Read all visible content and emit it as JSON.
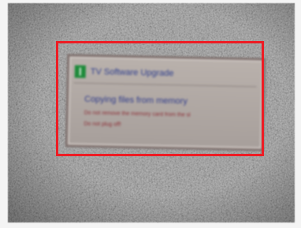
{
  "dialog": {
    "title": "TV Software Upgrade",
    "icon": "tv-app-icon",
    "message": "Copying files from memory",
    "warning_line1": "Do not remove the memory card from the sl",
    "warning_line2": "Do not plug off!"
  },
  "colors": {
    "highlight_border": "#ee1c24",
    "dialog_background": "#b1a9a5",
    "title_text": "#2c3c8c",
    "warning_text": "#8a2b33",
    "icon_background": "#1e8a3a"
  }
}
